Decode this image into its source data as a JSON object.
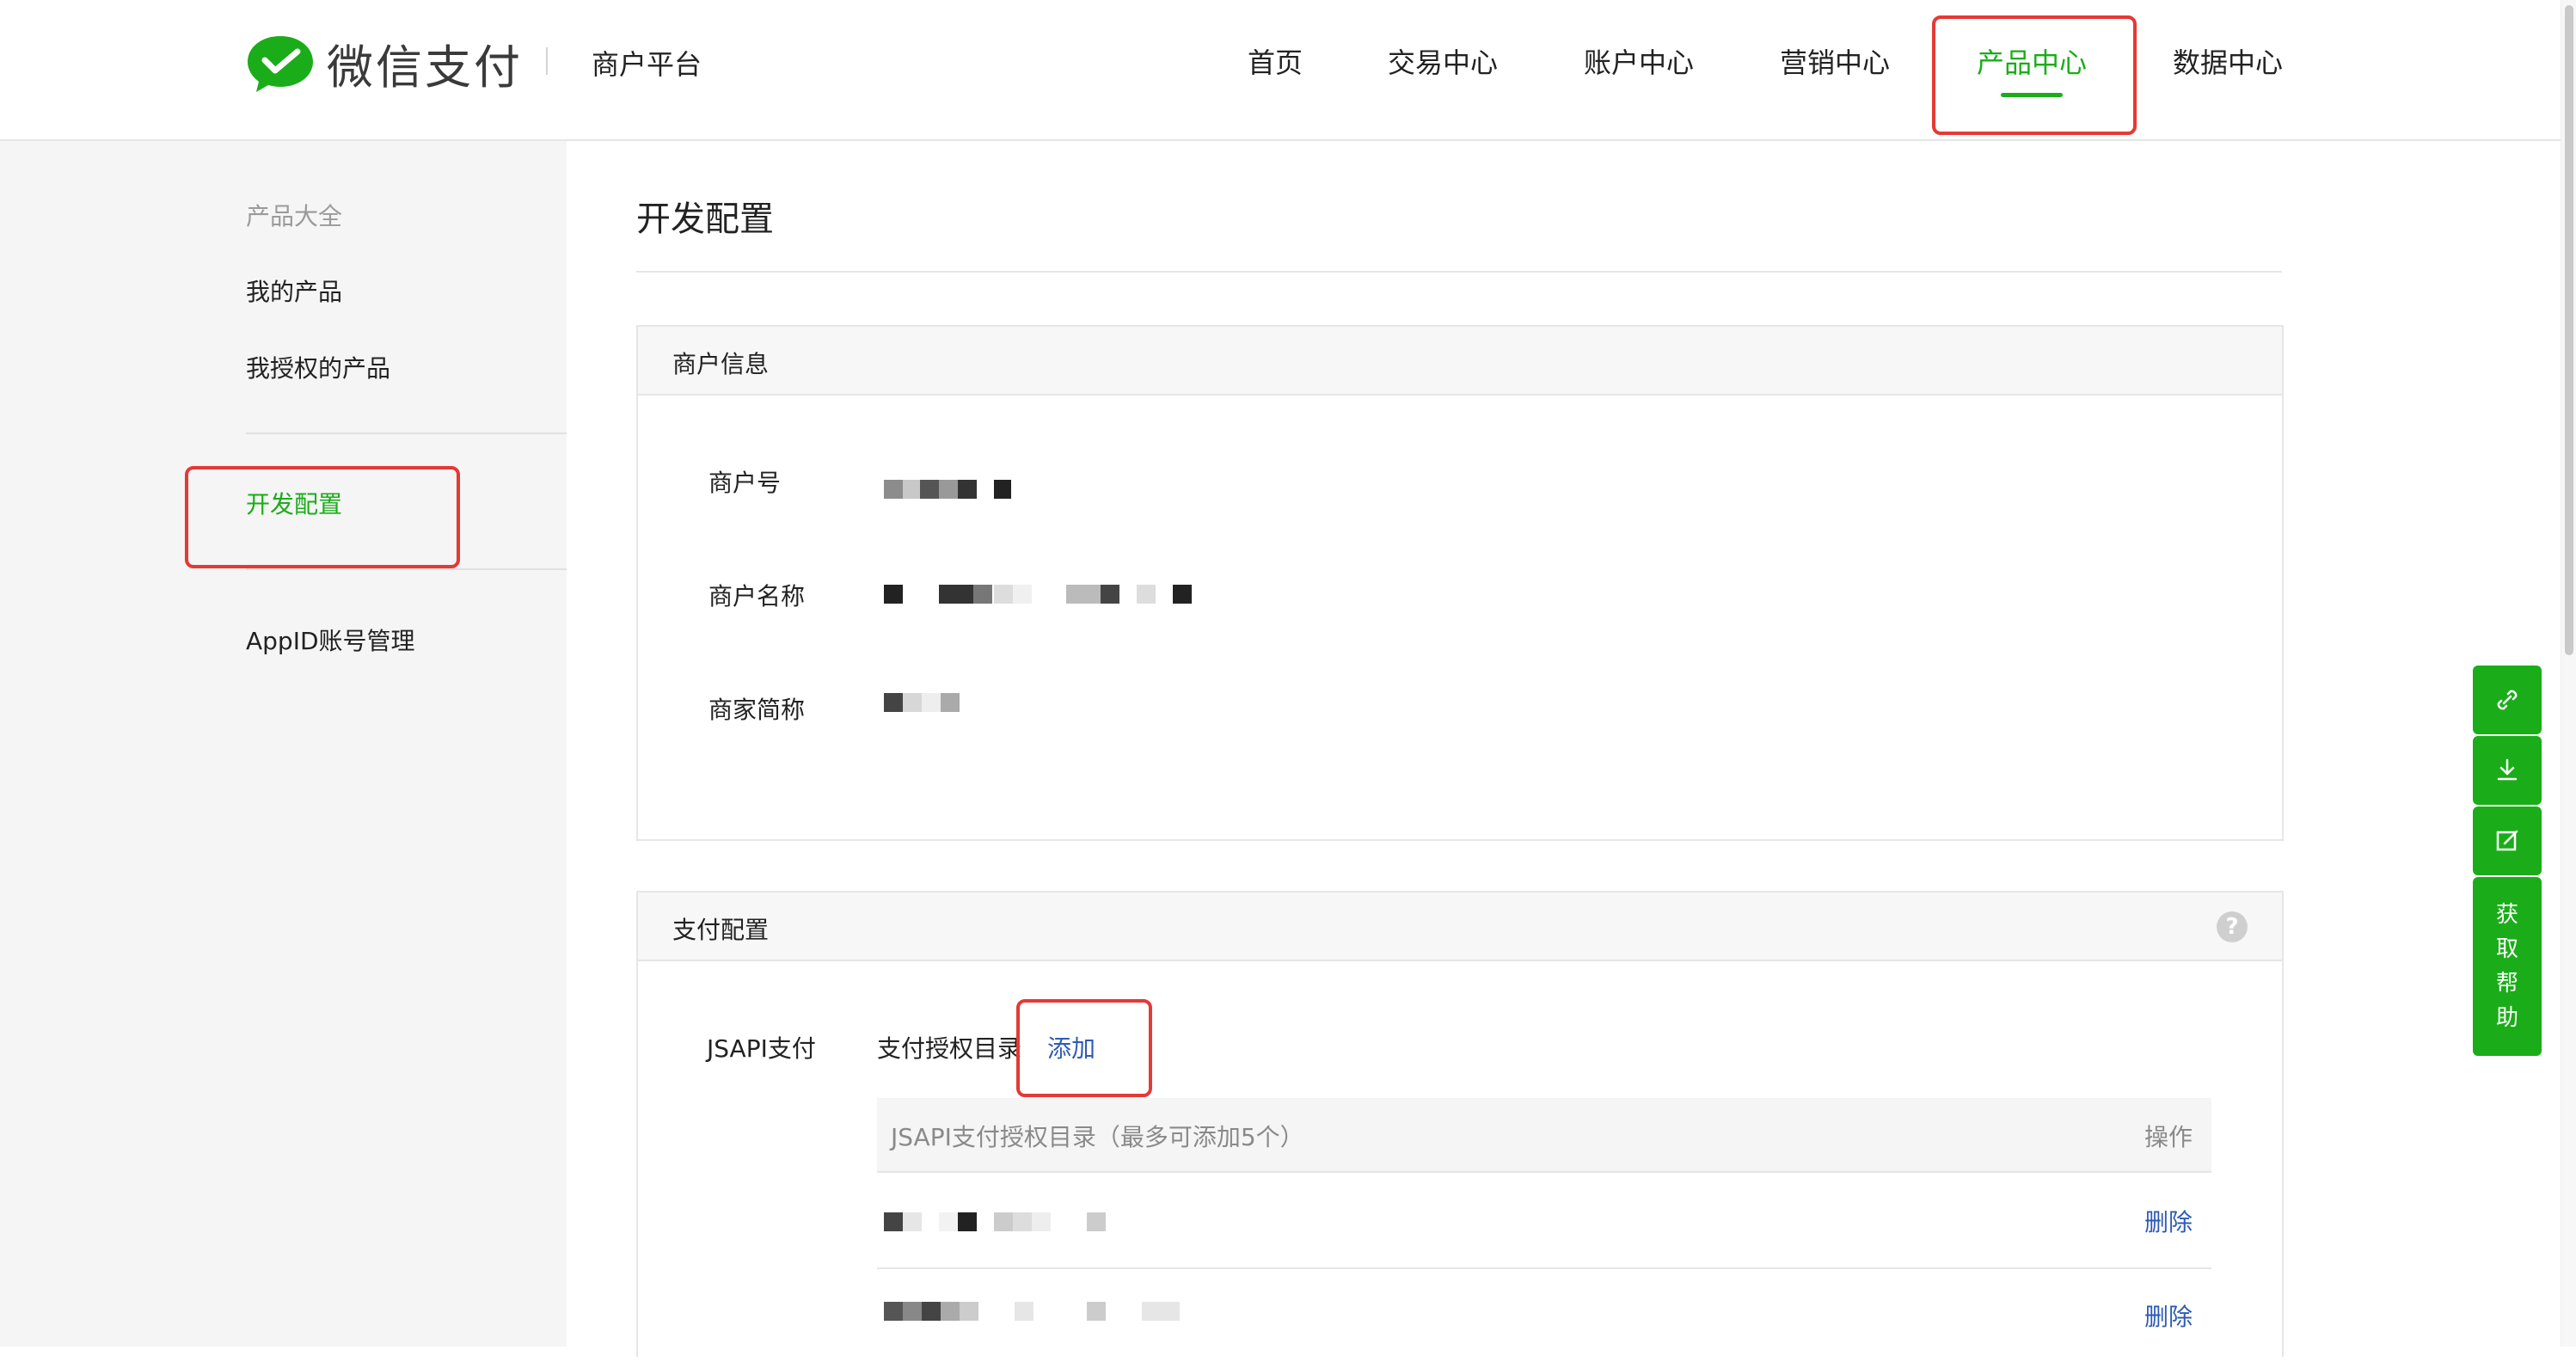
{
  "header": {
    "brand": "微信支付",
    "platform": "商户平台",
    "nav": [
      "首页",
      "交易中心",
      "账户中心",
      "营销中心",
      "产品中心",
      "数据中心"
    ],
    "active_nav": "产品中心",
    "accent_color": "#1aad19"
  },
  "sidebar": {
    "section_title": "产品大全",
    "items": [
      "我的产品",
      "我授权的产品",
      "开发配置",
      "AppID账号管理"
    ],
    "active_item": "开发配置"
  },
  "page": {
    "title": "开发配置"
  },
  "merchant_info": {
    "heading": "商户信息",
    "fields": [
      {
        "label": "商户号"
      },
      {
        "label": "商户名称"
      },
      {
        "label": "商家简称"
      }
    ]
  },
  "payment_config": {
    "heading": "支付配置",
    "help_icon": "question-circle-icon",
    "jsapi_label": "JSAPI支付",
    "dir_label": "支付授权目录",
    "add_label": "添加",
    "table": {
      "col_directory": "JSAPI支付授权目录（最多可添加5个）",
      "col_action": "操作",
      "rows": [
        {
          "action": "删除"
        },
        {
          "action": "删除"
        }
      ]
    }
  },
  "float_toolbar": {
    "icons": [
      "link-icon",
      "download-icon",
      "edit-icon"
    ],
    "help_label": [
      "获",
      "取",
      "帮",
      "助"
    ]
  }
}
